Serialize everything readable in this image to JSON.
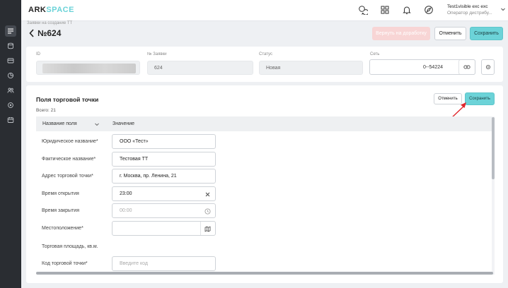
{
  "brand": {
    "part1": "ARK",
    "part2": "SPACE"
  },
  "user": {
    "name": "Test1visible exc exc",
    "role": "Оператор дистрибу..."
  },
  "breadcrumb": "Заявки на создание ТТ",
  "page_title": "№624",
  "header_buttons": {
    "pink": "Вернуть на доработку",
    "cancel": "Отменить",
    "save": "Сохранить"
  },
  "info": {
    "id_label": "ID",
    "num_label": "№ Заявки",
    "num_value": "624",
    "status_label": "Статус",
    "status_value": "Новая",
    "net_label": "Сеть",
    "net_value": "0--54224"
  },
  "section": {
    "title": "Поля торговой точки",
    "total": "Всего: 21",
    "cancel": "Отменить",
    "save": "Сохранить",
    "col_name": "Название поля",
    "col_value": "Значение"
  },
  "rows": [
    {
      "label": "Юридическое название*",
      "value": "ООО «Тест»",
      "placeholder": ""
    },
    {
      "label": "Фактическое название*",
      "value": "Тестовая ТТ",
      "placeholder": ""
    },
    {
      "label": "Адрес торговой точки*",
      "value": "г. Москва, пр. Ленина, 21",
      "placeholder": ""
    },
    {
      "label": "Время открытия",
      "value": "23:00",
      "placeholder": ""
    },
    {
      "label": "Время закрытия",
      "value": "",
      "placeholder": "00:00"
    },
    {
      "label": "Местоположение*",
      "value": "",
      "placeholder": ""
    },
    {
      "label": "Торговая площадь, кв.м.",
      "value": "",
      "placeholder": ""
    },
    {
      "label": "Код торговой точки*",
      "value": "",
      "placeholder": "Введите код"
    }
  ],
  "icons": {
    "rail": [
      "list-icon",
      "database-icon",
      "card-icon",
      "pie-icon",
      "users-icon",
      "settings-icon",
      "calendar-icon"
    ],
    "top": [
      "chat-icon",
      "grid-icon",
      "bell-icon",
      "compass-icon"
    ]
  },
  "colors": {
    "accent": "#6cd3d8",
    "rail": "#2a2d32",
    "pink": "#f8d5d5",
    "arrow": "#e0262b"
  }
}
